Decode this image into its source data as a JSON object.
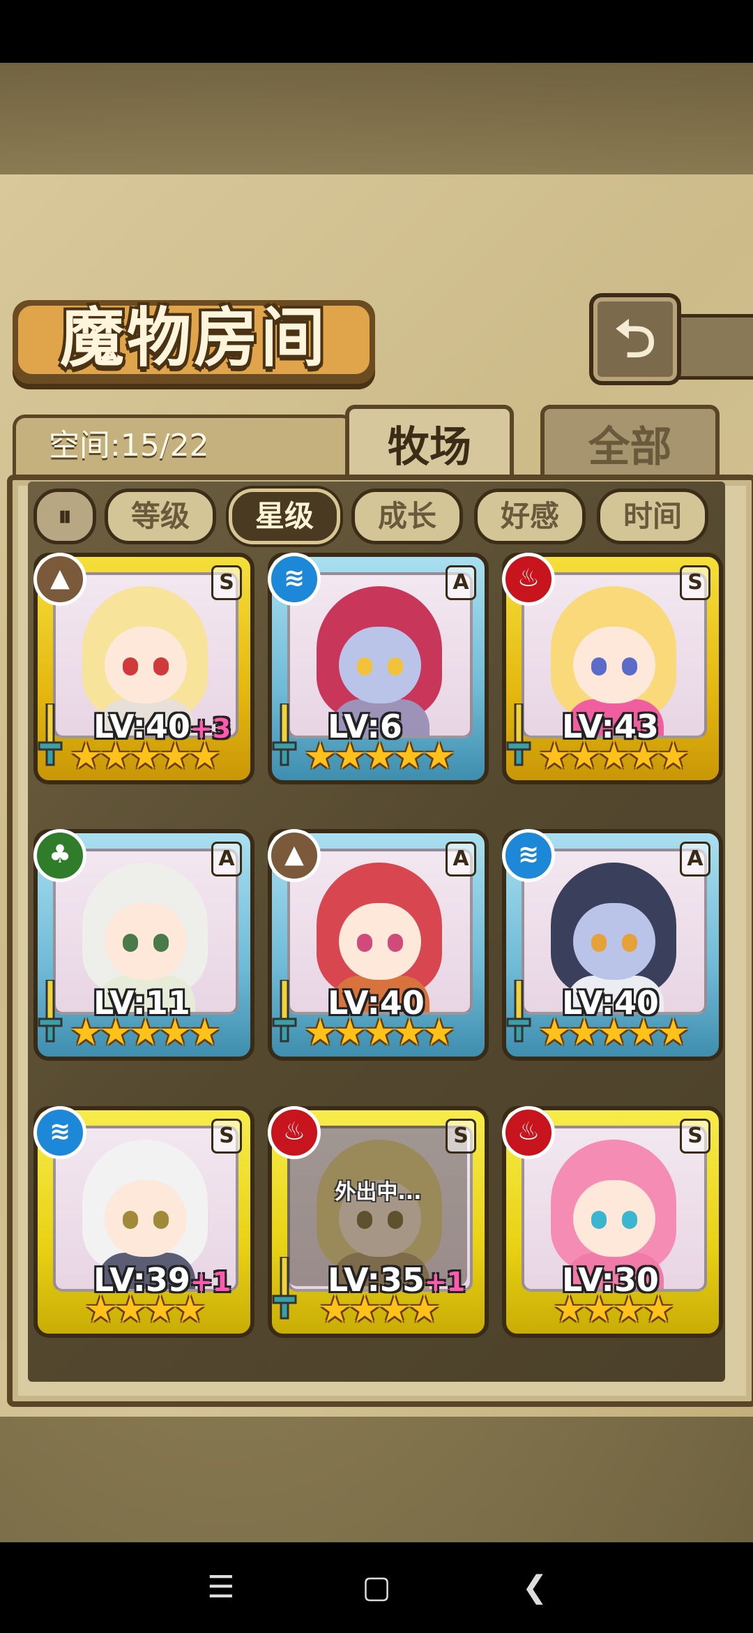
{
  "title": "魔物房间",
  "back_icon": "return-arrow-icon",
  "space": {
    "label": "空间:15/22"
  },
  "tabs": [
    {
      "label": "牧场",
      "active": true
    },
    {
      "label": "全部",
      "active": false
    }
  ],
  "filters": [
    {
      "label": "等级",
      "active": false
    },
    {
      "label": "星级",
      "active": true
    },
    {
      "label": "成长",
      "active": false
    },
    {
      "label": "好感",
      "active": false
    },
    {
      "label": "时间",
      "active": false
    }
  ],
  "monsters": [
    {
      "level": "LV:40",
      "bonus": "+3",
      "element": "earth",
      "rank": "S",
      "stars": "★★★★★",
      "frame": "gold",
      "weapon": true,
      "away": ""
    },
    {
      "level": "LV:6",
      "bonus": "",
      "element": "water",
      "rank": "A",
      "stars": "★★★★★",
      "frame": "blue",
      "weapon": true,
      "away": ""
    },
    {
      "level": "LV:43",
      "bonus": "",
      "element": "fire",
      "rank": "S",
      "stars": "★★★★★",
      "frame": "gold",
      "weapon": true,
      "away": ""
    },
    {
      "level": "LV:11",
      "bonus": "",
      "element": "wood",
      "rank": "A",
      "stars": "★★★★★",
      "frame": "blue",
      "weapon": true,
      "away": ""
    },
    {
      "level": "LV:40",
      "bonus": "",
      "element": "earth",
      "rank": "A",
      "stars": "★★★★★",
      "frame": "blue",
      "weapon": true,
      "away": ""
    },
    {
      "level": "LV:40",
      "bonus": "",
      "element": "water",
      "rank": "A",
      "stars": "★★★★★",
      "frame": "blue",
      "weapon": true,
      "away": ""
    },
    {
      "level": "LV:39",
      "bonus": "+1",
      "element": "water",
      "rank": "S",
      "stars": "★★★★",
      "frame": "yellow",
      "weapon": false,
      "away": ""
    },
    {
      "level": "LV:35",
      "bonus": "+1",
      "element": "fire",
      "rank": "S",
      "stars": "★★★★",
      "frame": "yellow",
      "weapon": true,
      "away": "外出中..."
    },
    {
      "level": "LV:30",
      "bonus": "",
      "element": "fire",
      "rank": "S",
      "stars": "★★★★",
      "frame": "yellow",
      "weapon": false,
      "away": ""
    }
  ],
  "element_glyphs": {
    "earth": "▲",
    "water": "≋",
    "fire": "♨",
    "wood": "♣"
  },
  "navbar": {
    "menu_icon": "☰",
    "home_icon": "▢",
    "back_icon": "❮"
  },
  "colors": {
    "accent": "#e4b80f",
    "panel_border": "#5a4526",
    "bonus": "#ff5ab0"
  }
}
